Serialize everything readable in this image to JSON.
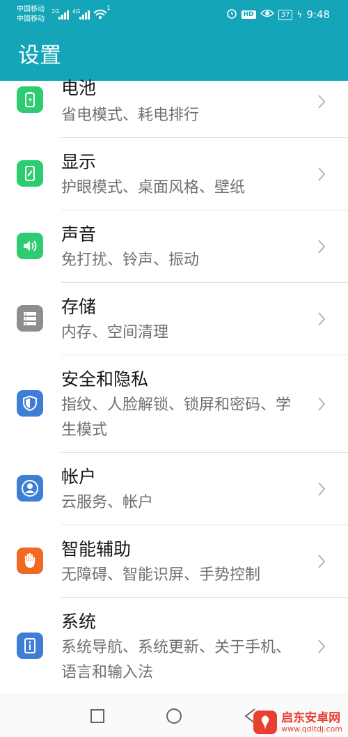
{
  "status_bar": {
    "carrier1": "中国移动",
    "carrier2": "中国移动",
    "sig1": "2G",
    "sig2": "4G",
    "wifi_badge": "1",
    "hd": "HD",
    "battery": "37",
    "time": "9:48"
  },
  "app_bar": {
    "title": "设置"
  },
  "items": [
    {
      "title": "电池",
      "subtitle": "省电模式、耗电排行",
      "icon": "battery-icon",
      "color": "#2ecc71"
    },
    {
      "title": "显示",
      "subtitle": "护眼模式、桌面风格、壁纸",
      "icon": "display-icon",
      "color": "#2ecc71"
    },
    {
      "title": "声音",
      "subtitle": "免打扰、铃声、振动",
      "icon": "sound-icon",
      "color": "#2ecc71"
    },
    {
      "title": "存储",
      "subtitle": "内存、空间清理",
      "icon": "storage-icon",
      "color": "#8e8e8e"
    },
    {
      "title": "安全和隐私",
      "subtitle": "指纹、人脸解锁、锁屏和密码、学生模式",
      "icon": "shield-icon",
      "color": "#3e7fd5"
    },
    {
      "title": "帐户",
      "subtitle": "云服务、帐户",
      "icon": "account-icon",
      "color": "#3e7fd5"
    },
    {
      "title": "智能辅助",
      "subtitle": "无障碍、智能识屏、手势控制",
      "icon": "hand-icon",
      "color": "#f26a22"
    },
    {
      "title": "系统",
      "subtitle": "系统导航、系统更新、关于手机、语言和输入法",
      "icon": "system-info-icon",
      "color": "#3e7fd5"
    }
  ],
  "watermark": {
    "name": "启东安卓网",
    "url": "www.qdltdj.com"
  }
}
